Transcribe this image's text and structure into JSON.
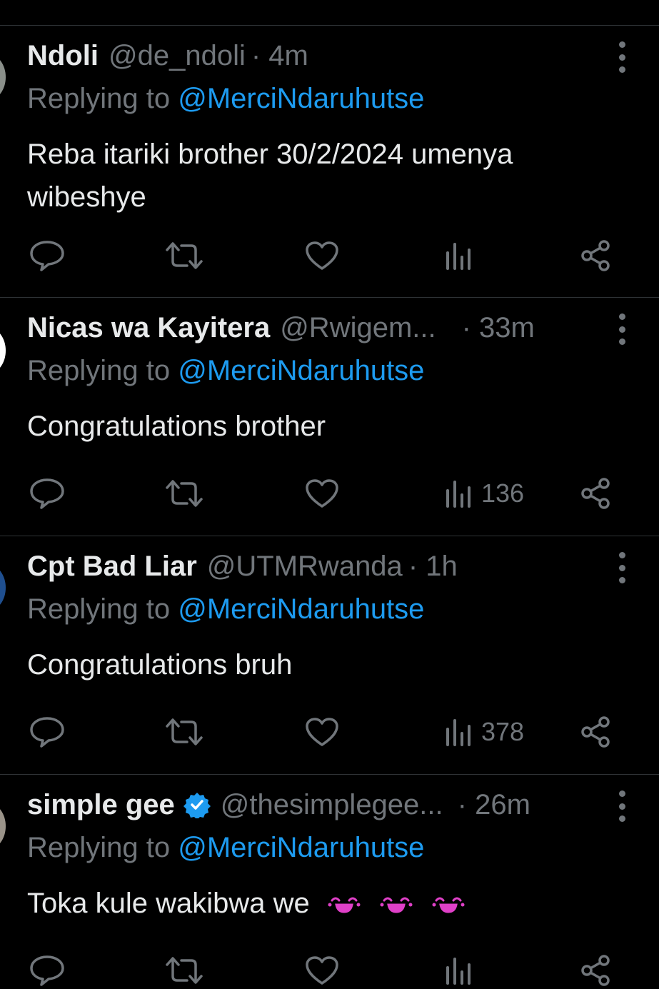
{
  "colors": {
    "background": "#000000",
    "text_primary": "#e7e9ea",
    "text_secondary": "#71767b",
    "link": "#1d9bf0",
    "divider": "#2f3336"
  },
  "replies": [
    {
      "name": "Ndoli",
      "handle": "@de_ndoli",
      "time": "· 4m",
      "replying_label": "Replying to",
      "replying_to": "@MerciNdaruhutse",
      "text": "Reba itariki brother 30/2/2024 umenya wibeshye",
      "views": "",
      "verified": false
    },
    {
      "name": "Nicas wa Kayitera",
      "handle": "@Rwigem...",
      "time": "· 33m",
      "replying_label": "Replying to",
      "replying_to": "@MerciNdaruhutse",
      "text": "Congratulations brother",
      "views": "136",
      "verified": false
    },
    {
      "name": "Cpt Bad Liar",
      "handle": "@UTMRwanda",
      "time": "· 1h",
      "replying_label": "Replying to",
      "replying_to": "@MerciNdaruhutse",
      "text": "Congratulations bruh",
      "views": "378",
      "verified": false
    },
    {
      "name": "simple gee",
      "handle": "@thesimplegee...",
      "time": "· 26m",
      "replying_label": "Replying to",
      "replying_to": "@MerciNdaruhutse",
      "text": "Toka kule wakibwa we",
      "emoji": [
        "laughing-emoji",
        "laughing-emoji",
        "laughing-emoji"
      ],
      "views": "",
      "verified": true
    }
  ],
  "icons": {
    "reply": "reply-icon",
    "repost": "repost-icon",
    "like": "like-icon",
    "views": "views-icon",
    "share": "share-icon",
    "more": "more-icon",
    "verified": "verified-badge-icon"
  }
}
